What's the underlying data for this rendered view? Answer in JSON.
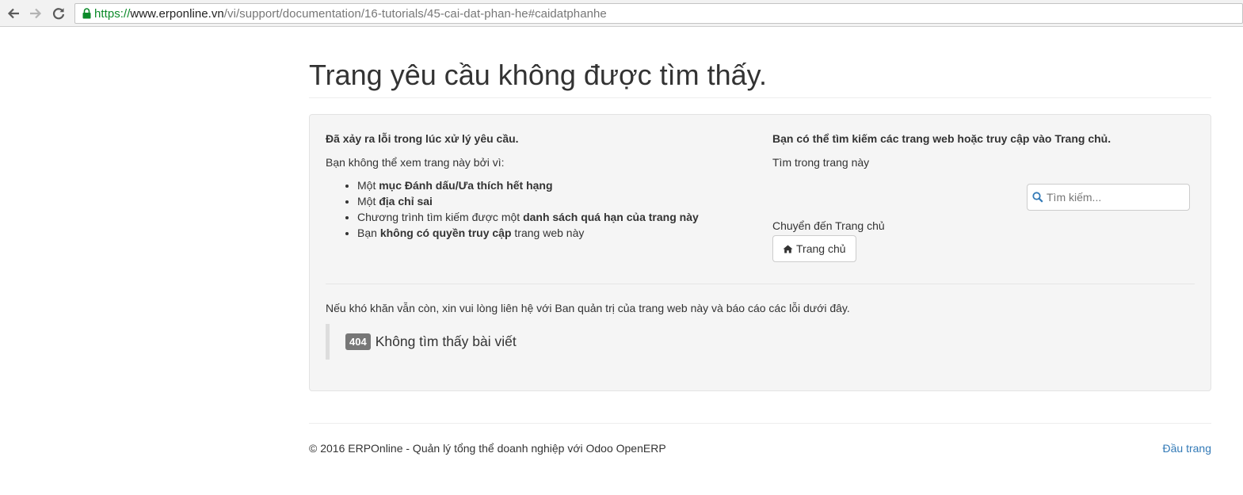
{
  "browser": {
    "url_scheme": "https://",
    "url_host": "www.erponline.vn",
    "url_path": "/vi/support/documentation/16-tutorials/45-cai-dat-phan-he#caidatphanhe"
  },
  "page": {
    "title": "Trang yêu cầu không được tìm thấy."
  },
  "error_box": {
    "left": {
      "heading": "Đã xảy ra lỗi trong lúc xử lý yêu cầu.",
      "intro": "Bạn không thể xem trang này bởi vì:",
      "reasons": [
        {
          "pre": "Một ",
          "bold": "mục Đánh dấu/Ưa thích hết hạng",
          "post": ""
        },
        {
          "pre": "Một ",
          "bold": "địa chỉ sai",
          "post": ""
        },
        {
          "pre": "Chương trình tìm kiếm được một ",
          "bold": "danh sách quá hạn của trang này",
          "post": ""
        },
        {
          "pre": "Bạn ",
          "bold": "không có quyền truy cập",
          "post": " trang web này"
        }
      ]
    },
    "right": {
      "heading": "Bạn có thể tìm kiếm các trang web hoặc truy cập vào Trang chủ.",
      "search_label": "Tìm trong trang này",
      "search_placeholder": "Tìm kiếm...",
      "home_label": "Chuyển đến Trang chủ",
      "home_button": "Trang chủ"
    },
    "contact_text": "Nếu khó khăn vẫn còn, xin vui lòng liên hệ với Ban quản trị của trang web này và báo cáo các lỗi dưới đây.",
    "error_code": "404",
    "error_message": "Không tìm thấy bài viết"
  },
  "footer": {
    "copyright": "© 2016 ERPOnline - Quản lý tổng thể doanh nghiệp với Odoo OpenERP",
    "back_to_top": "Đầu trang"
  },
  "colors": {
    "link": "#337ab7",
    "badge": "#777777",
    "well_bg": "#f5f5f5",
    "url_scheme": "#0b8a29"
  }
}
